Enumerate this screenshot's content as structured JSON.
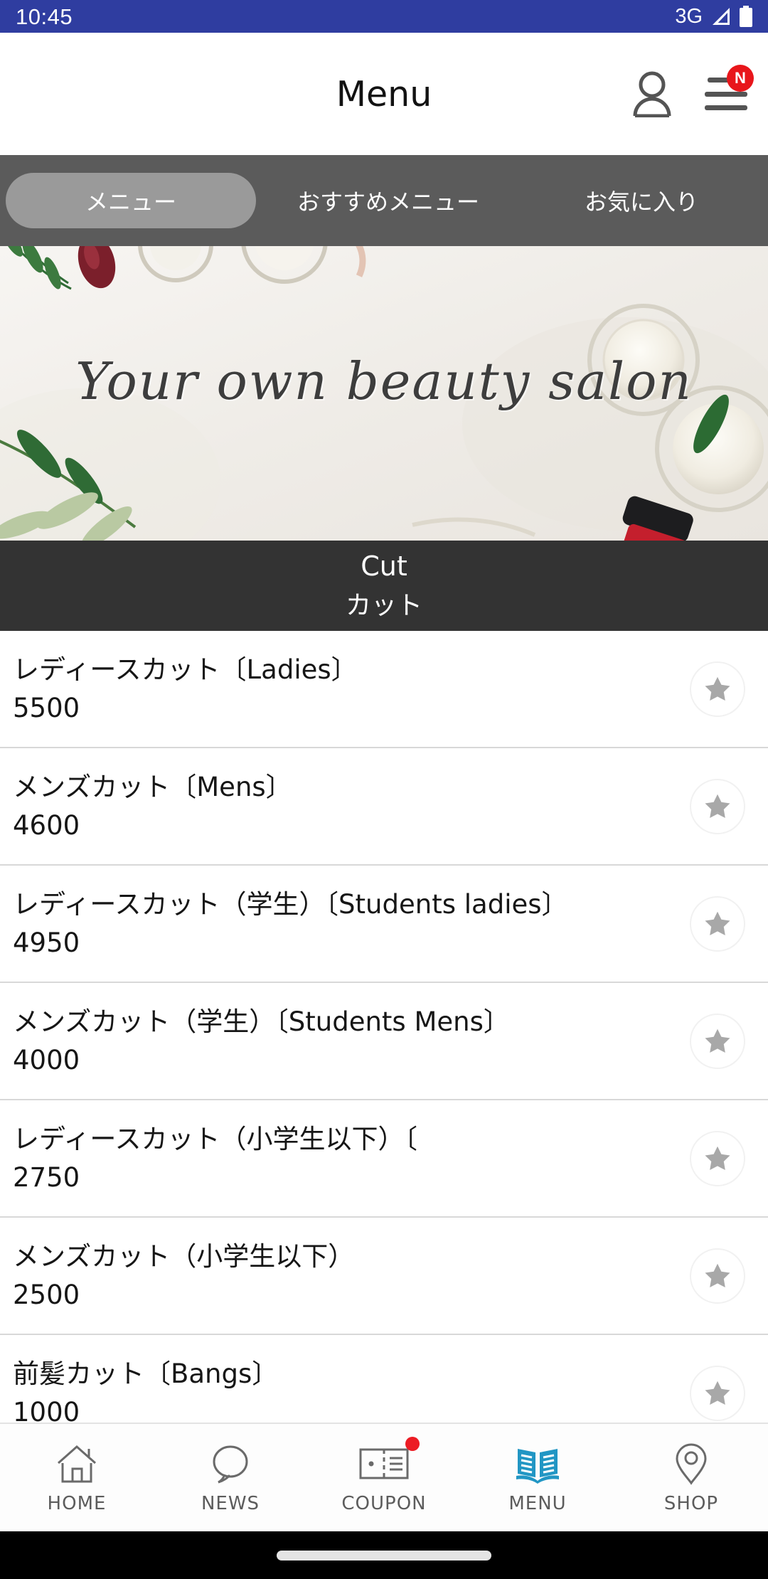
{
  "status_bar": {
    "time": "10:45",
    "network": "3G",
    "signal_icon": "signal-triangle-icon",
    "battery_icon": "battery-full-icon",
    "background_color": "#2f3da0"
  },
  "app_bar": {
    "title": "Menu",
    "account_icon": "person-icon",
    "menu_icon": "hamburger-menu-icon",
    "menu_badge": "N",
    "badge_color": "#e8161b"
  },
  "tabs": [
    {
      "label": "メニュー",
      "active": true
    },
    {
      "label": "おすすめメニュー",
      "active": false
    },
    {
      "label": "お気に入り",
      "active": false
    }
  ],
  "hero": {
    "script_text": "Your own beauty salon",
    "alt": "beauty salon banner with olive branches and cosmetic jars"
  },
  "section": {
    "title_en": "Cut",
    "title_ja": "カット",
    "background_color": "#333333"
  },
  "menu_items": [
    {
      "name": "レディースカット〔Ladies〕",
      "price": "5500",
      "favorite_icon": "star-icon"
    },
    {
      "name": "メンズカット〔Mens〕",
      "price": "4600",
      "favorite_icon": "star-icon"
    },
    {
      "name": "レディースカット（学生）〔Students ladies〕",
      "price": "4950",
      "favorite_icon": "star-icon"
    },
    {
      "name": "メンズカット（学生）〔Students Mens〕",
      "price": "4000",
      "favorite_icon": "star-icon"
    },
    {
      "name": "レディースカット（小学生以下）〔",
      "price": "2750",
      "favorite_icon": "star-icon"
    },
    {
      "name": "メンズカット（小学生以下）",
      "price": "2500",
      "favorite_icon": "star-icon"
    },
    {
      "name": "前髪カット〔Bangs〕",
      "price": "1000",
      "favorite_icon": "star-icon"
    }
  ],
  "bottom_nav": {
    "active_color": "#2196c4",
    "items": [
      {
        "label": "HOME",
        "icon": "home-icon",
        "active": false,
        "badge": false
      },
      {
        "label": "NEWS",
        "icon": "speech-bubble-icon",
        "active": false,
        "badge": false
      },
      {
        "label": "COUPON",
        "icon": "ticket-icon",
        "active": false,
        "badge": true
      },
      {
        "label": "MENU",
        "icon": "open-book-icon",
        "active": true,
        "badge": false
      },
      {
        "label": "SHOP",
        "icon": "map-pin-icon",
        "active": false,
        "badge": false
      }
    ]
  }
}
